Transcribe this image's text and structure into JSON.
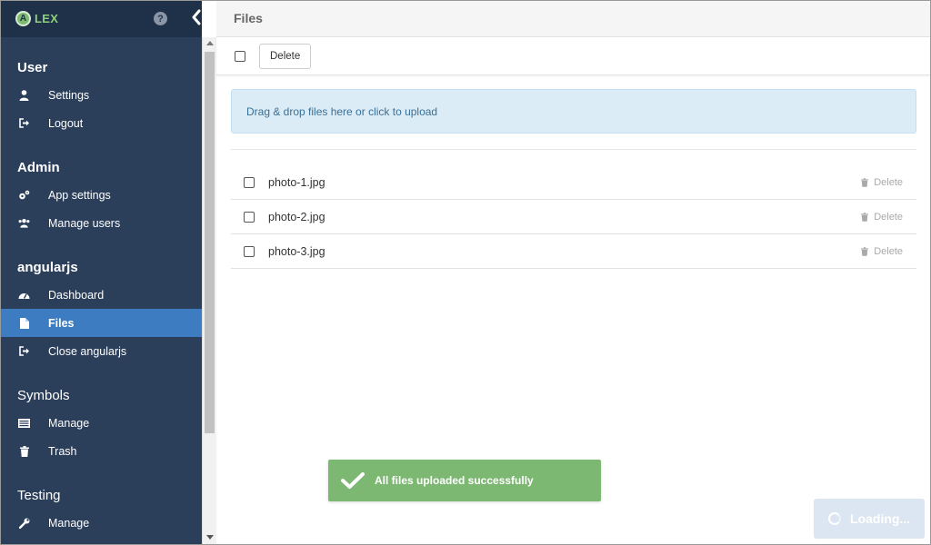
{
  "brand": {
    "logo_letter": "A",
    "name": "LEX"
  },
  "sidebar": {
    "help_glyph": "?",
    "groups": [
      {
        "title": "User",
        "items": [
          {
            "label": "Settings",
            "icon": "user-icon"
          },
          {
            "label": "Logout",
            "icon": "logout-icon"
          }
        ]
      },
      {
        "title": "Admin",
        "items": [
          {
            "label": "App settings",
            "icon": "gears-icon"
          },
          {
            "label": "Manage users",
            "icon": "users-icon"
          }
        ]
      },
      {
        "title": "angularjs",
        "items": [
          {
            "label": "Dashboard",
            "icon": "dashboard-icon"
          },
          {
            "label": "Files",
            "icon": "file-icon",
            "active": true
          },
          {
            "label": "Close angularjs",
            "icon": "logout-icon"
          }
        ]
      },
      {
        "title": "Symbols",
        "items": [
          {
            "label": "Manage",
            "icon": "list-icon"
          },
          {
            "label": "Trash",
            "icon": "trash-icon"
          }
        ]
      },
      {
        "title": "Testing",
        "items": [
          {
            "label": "Manage",
            "icon": "wrench-icon"
          }
        ]
      }
    ]
  },
  "header": {
    "title": "Files"
  },
  "toolbar": {
    "delete_label": "Delete"
  },
  "dropzone": {
    "text": "Drag & drop files here or click to upload"
  },
  "files": [
    {
      "name": "photo-1.jpg",
      "delete_label": "Delete"
    },
    {
      "name": "photo-2.jpg",
      "delete_label": "Delete"
    },
    {
      "name": "photo-3.jpg",
      "delete_label": "Delete"
    }
  ],
  "toast": {
    "message": "All files uploaded successfully"
  },
  "loading": {
    "text": "Loading..."
  },
  "colors": {
    "sidebar_bg": "#2b3e5a",
    "active_item": "#3e7cc1",
    "toast_bg": "#7db873",
    "dropzone_bg": "#dbecf7"
  }
}
